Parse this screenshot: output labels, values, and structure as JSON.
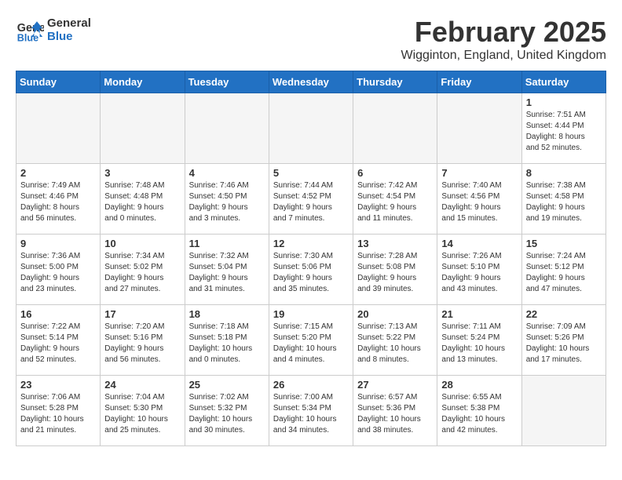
{
  "header": {
    "logo_line1": "General",
    "logo_line2": "Blue",
    "month_title": "February 2025",
    "location": "Wigginton, England, United Kingdom"
  },
  "weekdays": [
    "Sunday",
    "Monday",
    "Tuesday",
    "Wednesday",
    "Thursday",
    "Friday",
    "Saturday"
  ],
  "weeks": [
    [
      {
        "day": "",
        "info": "",
        "empty": true
      },
      {
        "day": "",
        "info": "",
        "empty": true
      },
      {
        "day": "",
        "info": "",
        "empty": true
      },
      {
        "day": "",
        "info": "",
        "empty": true
      },
      {
        "day": "",
        "info": "",
        "empty": true
      },
      {
        "day": "",
        "info": "",
        "empty": true
      },
      {
        "day": "1",
        "info": "Sunrise: 7:51 AM\nSunset: 4:44 PM\nDaylight: 8 hours\nand 52 minutes.",
        "empty": false
      }
    ],
    [
      {
        "day": "2",
        "info": "Sunrise: 7:49 AM\nSunset: 4:46 PM\nDaylight: 8 hours\nand 56 minutes.",
        "empty": false
      },
      {
        "day": "3",
        "info": "Sunrise: 7:48 AM\nSunset: 4:48 PM\nDaylight: 9 hours\nand 0 minutes.",
        "empty": false
      },
      {
        "day": "4",
        "info": "Sunrise: 7:46 AM\nSunset: 4:50 PM\nDaylight: 9 hours\nand 3 minutes.",
        "empty": false
      },
      {
        "day": "5",
        "info": "Sunrise: 7:44 AM\nSunset: 4:52 PM\nDaylight: 9 hours\nand 7 minutes.",
        "empty": false
      },
      {
        "day": "6",
        "info": "Sunrise: 7:42 AM\nSunset: 4:54 PM\nDaylight: 9 hours\nand 11 minutes.",
        "empty": false
      },
      {
        "day": "7",
        "info": "Sunrise: 7:40 AM\nSunset: 4:56 PM\nDaylight: 9 hours\nand 15 minutes.",
        "empty": false
      },
      {
        "day": "8",
        "info": "Sunrise: 7:38 AM\nSunset: 4:58 PM\nDaylight: 9 hours\nand 19 minutes.",
        "empty": false
      }
    ],
    [
      {
        "day": "9",
        "info": "Sunrise: 7:36 AM\nSunset: 5:00 PM\nDaylight: 9 hours\nand 23 minutes.",
        "empty": false
      },
      {
        "day": "10",
        "info": "Sunrise: 7:34 AM\nSunset: 5:02 PM\nDaylight: 9 hours\nand 27 minutes.",
        "empty": false
      },
      {
        "day": "11",
        "info": "Sunrise: 7:32 AM\nSunset: 5:04 PM\nDaylight: 9 hours\nand 31 minutes.",
        "empty": false
      },
      {
        "day": "12",
        "info": "Sunrise: 7:30 AM\nSunset: 5:06 PM\nDaylight: 9 hours\nand 35 minutes.",
        "empty": false
      },
      {
        "day": "13",
        "info": "Sunrise: 7:28 AM\nSunset: 5:08 PM\nDaylight: 9 hours\nand 39 minutes.",
        "empty": false
      },
      {
        "day": "14",
        "info": "Sunrise: 7:26 AM\nSunset: 5:10 PM\nDaylight: 9 hours\nand 43 minutes.",
        "empty": false
      },
      {
        "day": "15",
        "info": "Sunrise: 7:24 AM\nSunset: 5:12 PM\nDaylight: 9 hours\nand 47 minutes.",
        "empty": false
      }
    ],
    [
      {
        "day": "16",
        "info": "Sunrise: 7:22 AM\nSunset: 5:14 PM\nDaylight: 9 hours\nand 52 minutes.",
        "empty": false
      },
      {
        "day": "17",
        "info": "Sunrise: 7:20 AM\nSunset: 5:16 PM\nDaylight: 9 hours\nand 56 minutes.",
        "empty": false
      },
      {
        "day": "18",
        "info": "Sunrise: 7:18 AM\nSunset: 5:18 PM\nDaylight: 10 hours\nand 0 minutes.",
        "empty": false
      },
      {
        "day": "19",
        "info": "Sunrise: 7:15 AM\nSunset: 5:20 PM\nDaylight: 10 hours\nand 4 minutes.",
        "empty": false
      },
      {
        "day": "20",
        "info": "Sunrise: 7:13 AM\nSunset: 5:22 PM\nDaylight: 10 hours\nand 8 minutes.",
        "empty": false
      },
      {
        "day": "21",
        "info": "Sunrise: 7:11 AM\nSunset: 5:24 PM\nDaylight: 10 hours\nand 13 minutes.",
        "empty": false
      },
      {
        "day": "22",
        "info": "Sunrise: 7:09 AM\nSunset: 5:26 PM\nDaylight: 10 hours\nand 17 minutes.",
        "empty": false
      }
    ],
    [
      {
        "day": "23",
        "info": "Sunrise: 7:06 AM\nSunset: 5:28 PM\nDaylight: 10 hours\nand 21 minutes.",
        "empty": false
      },
      {
        "day": "24",
        "info": "Sunrise: 7:04 AM\nSunset: 5:30 PM\nDaylight: 10 hours\nand 25 minutes.",
        "empty": false
      },
      {
        "day": "25",
        "info": "Sunrise: 7:02 AM\nSunset: 5:32 PM\nDaylight: 10 hours\nand 30 minutes.",
        "empty": false
      },
      {
        "day": "26",
        "info": "Sunrise: 7:00 AM\nSunset: 5:34 PM\nDaylight: 10 hours\nand 34 minutes.",
        "empty": false
      },
      {
        "day": "27",
        "info": "Sunrise: 6:57 AM\nSunset: 5:36 PM\nDaylight: 10 hours\nand 38 minutes.",
        "empty": false
      },
      {
        "day": "28",
        "info": "Sunrise: 6:55 AM\nSunset: 5:38 PM\nDaylight: 10 hours\nand 42 minutes.",
        "empty": false
      },
      {
        "day": "",
        "info": "",
        "empty": true
      }
    ]
  ]
}
